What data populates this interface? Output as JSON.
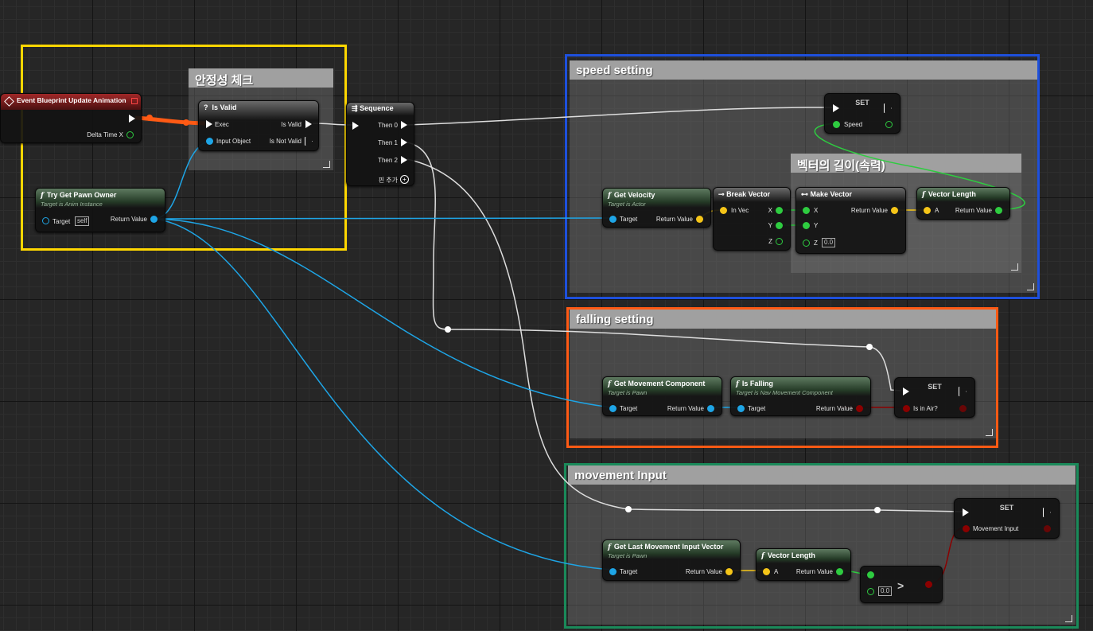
{
  "comments": {
    "validity": "안정성 체크",
    "speed": "speed setting",
    "length": "벡터의 길이(속력)",
    "falling": "falling setting",
    "movement": "movement Input"
  },
  "nodes": {
    "event": {
      "title": "Event Blueprint Update Animation",
      "delta": "Delta Time X"
    },
    "is_valid": {
      "title": "Is Valid",
      "exec": "Exec",
      "input": "Input Object",
      "valid": "Is Valid",
      "not_valid": "Is Not Valid"
    },
    "sequence": {
      "title": "Sequence",
      "then0": "Then 0",
      "then1": "Then 1",
      "then2": "Then 2",
      "add_pin": "핀 추가"
    },
    "pawn_owner": {
      "title": "Try Get Pawn Owner",
      "subtitle": "Target is Anim Instance",
      "target": "Target",
      "self": "self",
      "ret": "Return Value"
    },
    "set_speed": {
      "title": "SET",
      "pin": "Speed"
    },
    "get_velocity": {
      "title": "Get Velocity",
      "subtitle": "Target is Actor",
      "target": "Target",
      "ret": "Return Value"
    },
    "break_vector": {
      "title": "Break Vector",
      "in": "In Vec",
      "x": "X",
      "y": "Y",
      "z": "Z"
    },
    "make_vector": {
      "title": "Make Vector",
      "x": "X",
      "y": "Y",
      "z": "Z",
      "z_default": "0.0",
      "ret": "Return Value"
    },
    "vector_length1": {
      "title": "Vector Length",
      "a": "A",
      "ret": "Return Value"
    },
    "get_movement": {
      "title": "Get Movement Component",
      "subtitle": "Target is Pawn",
      "target": "Target",
      "ret": "Return Value"
    },
    "is_falling": {
      "title": "Is Falling",
      "subtitle": "Target is Nav Movement Component",
      "target": "Target",
      "ret": "Return Value"
    },
    "set_air": {
      "title": "SET",
      "pin": "Is in Air?"
    },
    "set_input": {
      "title": "SET",
      "pin": "Movement Input"
    },
    "last_input": {
      "title": "Get Last Movement Input Vector",
      "subtitle": "Target is Pawn",
      "target": "Target",
      "ret": "Return Value"
    },
    "vector_length2": {
      "title": "Vector Length",
      "a": "A",
      "ret": "Return Value"
    },
    "greater": {
      "op": ">",
      "b_default": "0.0"
    }
  },
  "colors": {
    "exec": "#ffffff",
    "object": "#1ea5e6",
    "vector": "#f5c518",
    "float": "#2ecc40",
    "bool": "#8b0000",
    "highlight_yellow": "#ffd700",
    "highlight_blue": "#1e50dc",
    "highlight_orange": "#ff5a14",
    "highlight_green": "#1a8a5a"
  }
}
